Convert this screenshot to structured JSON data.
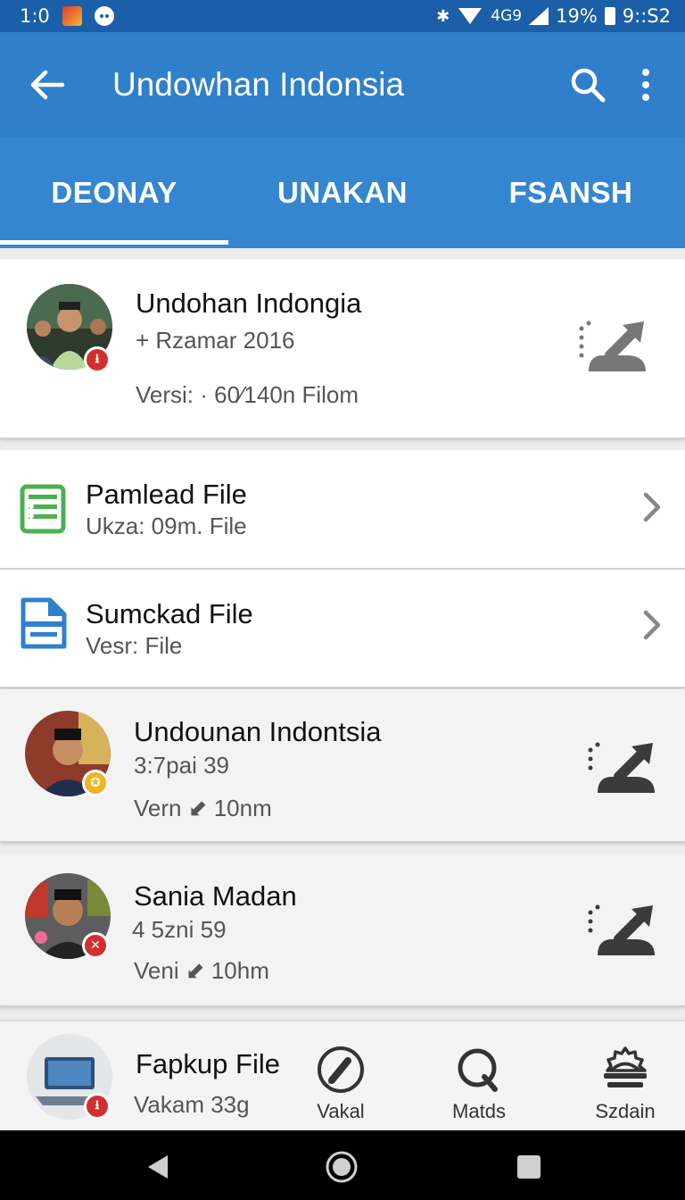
{
  "status_bar": {
    "time": "1:0",
    "network": "4G9",
    "battery": "19%",
    "clock_right": "9::S2"
  },
  "app_bar": {
    "title": "Undowhan Indonsia"
  },
  "tabs": [
    {
      "label": "DEONAY",
      "active": true
    },
    {
      "label": "UNAKAN",
      "active": false
    },
    {
      "label": "FSANSH",
      "active": false
    }
  ],
  "items": [
    {
      "title": "Undohan Indongia",
      "line2": "+ Rzamar 2016",
      "line3": "Versi: · 60⁄140n Filom",
      "badge_color": "#d32f2f"
    },
    {
      "title": "Pamlead File",
      "line2": "Ukza: 09m. File",
      "icon": "spreadsheet-icon",
      "icon_color": "#4caf50"
    },
    {
      "title": "Sumckad File",
      "line2": "Vesr: File",
      "icon": "document-icon",
      "icon_color": "#2f80cf"
    },
    {
      "title": "Undounan Indontsia",
      "line2": "3:7pai 39",
      "line3": "Vern ⬋ 10nm",
      "badge_color": "#f0b324"
    },
    {
      "title": "Sania Madan",
      "line2": "4 5zni 59",
      "line3": "Veni ⬋ 10hm",
      "badge_color": "#d32f2f"
    },
    {
      "title": "Fapkup File",
      "line2": "Vakam 33g",
      "badge_color": "#d32f2f"
    }
  ],
  "bottom_nav": [
    {
      "label": "Vakal",
      "icon": "pen-icon"
    },
    {
      "label": "Matds",
      "icon": "search-q-icon"
    },
    {
      "label": "Szdain",
      "icon": "badge-settings-icon"
    }
  ]
}
